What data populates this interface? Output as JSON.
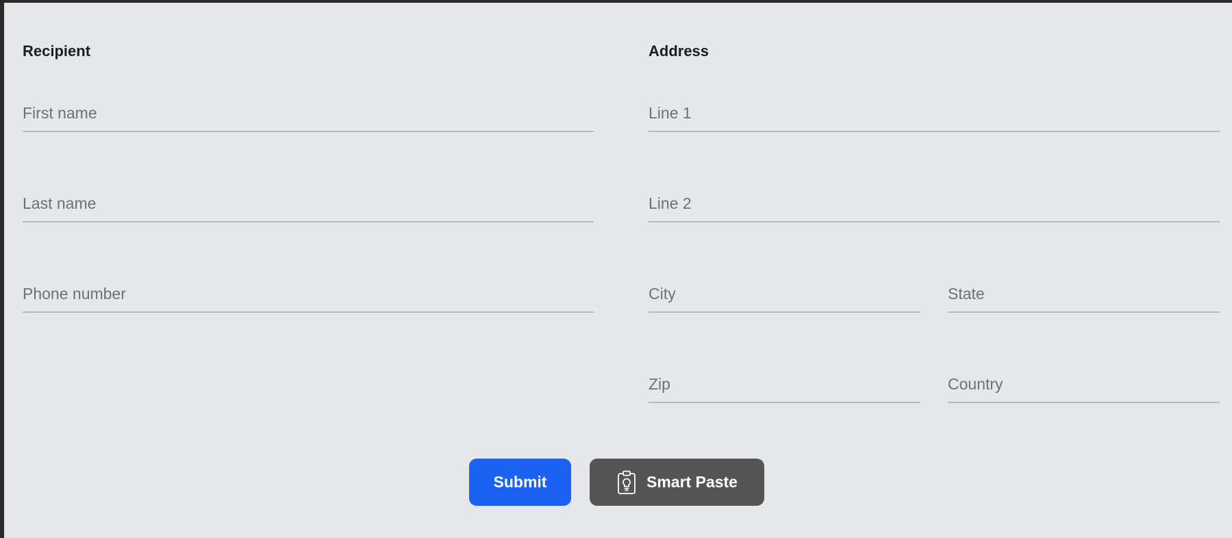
{
  "recipient": {
    "title": "Recipient",
    "first_name": {
      "placeholder": "First name",
      "value": ""
    },
    "last_name": {
      "placeholder": "Last name",
      "value": ""
    },
    "phone": {
      "placeholder": "Phone number",
      "value": ""
    }
  },
  "address": {
    "title": "Address",
    "line1": {
      "placeholder": "Line 1",
      "value": ""
    },
    "line2": {
      "placeholder": "Line 2",
      "value": ""
    },
    "city": {
      "placeholder": "City",
      "value": ""
    },
    "state": {
      "placeholder": "State",
      "value": ""
    },
    "zip": {
      "placeholder": "Zip",
      "value": ""
    },
    "country": {
      "placeholder": "Country",
      "value": ""
    }
  },
  "actions": {
    "submit_label": "Submit",
    "smart_paste_label": "Smart Paste",
    "smart_paste_icon": "clipboard-lightbulb-icon"
  },
  "colors": {
    "background": "#e6e7ea",
    "primary": "#1b62f2",
    "secondary": "#555555",
    "field_underline": "#b7b9be"
  }
}
